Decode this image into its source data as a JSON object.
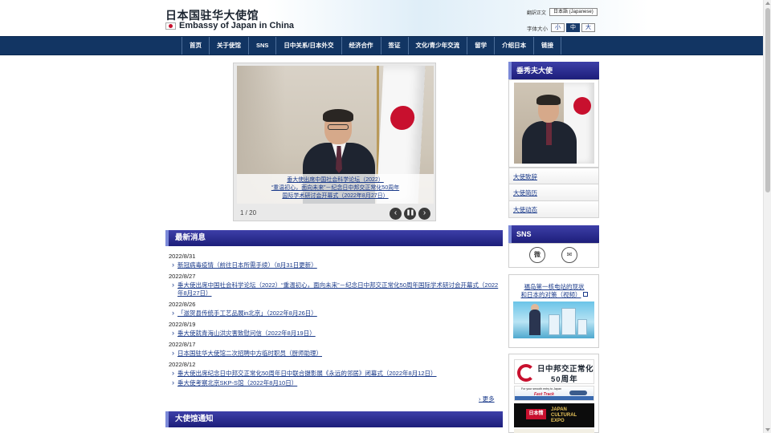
{
  "header": {
    "title": "日本国驻华大使馆",
    "subtitle": "Embassy of Japan in China",
    "lang_label": "翻訳正文",
    "lang_selected": "日本語 (Japanese)",
    "font_size_label": "字体大小",
    "font_sizes": [
      "小",
      "中",
      "大"
    ],
    "font_size_active": "中"
  },
  "nav": {
    "items": [
      "首页",
      "关于使馆",
      "SNS",
      "日中关系/日本外交",
      "经济合作",
      "签证",
      "文化/青少年交流",
      "留学",
      "介绍日本",
      "链接"
    ]
  },
  "slideshow": {
    "caption_lines": [
      "垂大使出席中国社会科学论坛（2022）",
      "“重温初心，面向未来”－纪念日中邦交正常化50周年",
      "国际学术研讨会开幕式（2022年8月27日）"
    ],
    "counter": "1 / 20",
    "prev_label": "‹",
    "pause_label": "❚❚",
    "next_label": "›"
  },
  "news": {
    "heading": "最新消息",
    "groups": [
      {
        "date": "2022/8/31",
        "items": [
          "新冠病毒疫情（前往日本所需手续）（8月31日更新）"
        ]
      },
      {
        "date": "2022/8/27",
        "items": [
          "垂大使出席中国社会科学论坛（2022）“重温初心，面向未来”－纪念日中邦交正常化50周年国际学术研讨会开幕式（2022年8月27日）"
        ]
      },
      {
        "date": "2022/8/26",
        "items": [
          "「滋贺县传统手工艺品展in北京」（2022年8月26日）"
        ]
      },
      {
        "date": "2022/8/19",
        "items": [
          "垂大使就青海山洪灾害致慰问信（2022年8月19日）"
        ]
      },
      {
        "date": "2022/8/17",
        "items": [
          "日本国驻华大使馆二次招聘中方临时职员（厨师助理）"
        ]
      },
      {
        "date": "2022/8/12",
        "items": [
          "垂大使出席纪念日中邦交正常化50周年日中联合摄影展《永远的邻居》闭幕式（2022年8月12日）",
          "垂大使考察北京SKP-S馆（2022年8月10日）"
        ]
      }
    ],
    "more": "更多"
  },
  "notice": {
    "heading": "大使馆通知"
  },
  "sidebar": {
    "ambassador": {
      "heading": "垂秀夫大使",
      "links": [
        "大使致辞",
        "大使简历",
        "大使动态"
      ]
    },
    "sns": {
      "heading": "SNS",
      "icons": [
        "weibo-icon",
        "wechat-icon"
      ]
    },
    "fukushima": {
      "lines": [
        "福岛第一核电站的现状",
        "和日本的对策（视频）"
      ]
    },
    "banners": {
      "b1_line1": "日中邦交正常化",
      "b1_line2": "50周年",
      "b2_tiny": "For your smooth entry to Japan",
      "b2_title": "Fast Track",
      "b3_badge": "日本情",
      "b3_l1": "JAPAN",
      "b3_l2": "CULTURAL",
      "b3_l3": "EXPO"
    }
  },
  "colors": {
    "nav_bg": "#123563",
    "section_head": "#1d1e7a",
    "link": "#1a3a8a",
    "flag_red": "#c8102e"
  }
}
